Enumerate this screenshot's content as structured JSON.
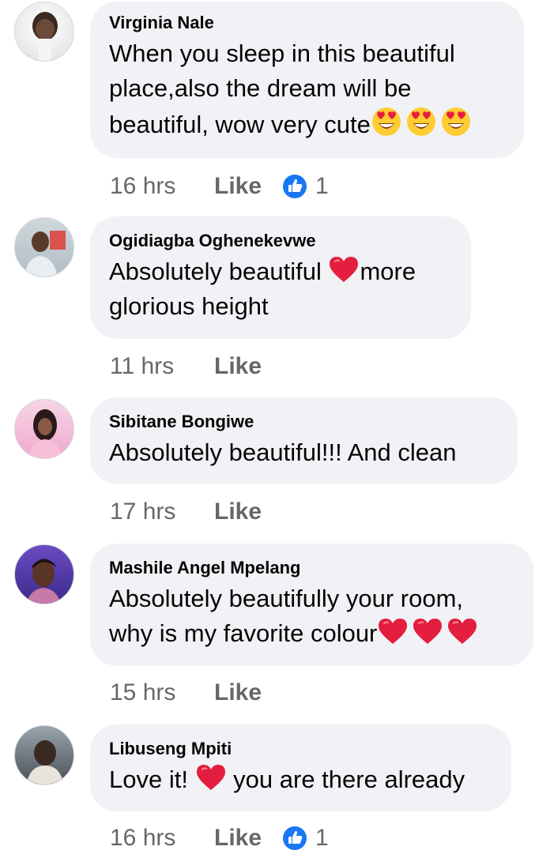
{
  "comments": [
    {
      "author": "Virginia Nale",
      "text_parts": [
        "When you sleep in this beautiful place,also the dream will be beautiful, wow very cute"
      ],
      "emojis": [
        "heart-eyes-emoji",
        "heart-eyes-emoji",
        "heart-eyes-emoji"
      ],
      "time": "16 hrs",
      "like_label": "Like",
      "reaction_count": "1"
    },
    {
      "author": "Ogidiagba Oghenekevwe",
      "text_parts": [
        "Absolutely beautiful ",
        "more glorious height"
      ],
      "emojis": [
        "red-heart-emoji"
      ],
      "time": "11 hrs",
      "like_label": "Like"
    },
    {
      "author": "Sibitane Bongiwe",
      "text_parts": [
        "Absolutely beautiful!!! And clean"
      ],
      "time": "17 hrs",
      "like_label": "Like"
    },
    {
      "author": "Mashile Angel Mpelang",
      "text_parts": [
        "Absolutely beautifully your room, why is my favorite colour"
      ],
      "emojis": [
        "red-heart-emoji",
        "red-heart-emoji",
        "red-heart-emoji"
      ],
      "time": "15 hrs",
      "like_label": "Like"
    },
    {
      "author": "Libuseng Mpiti",
      "text_parts": [
        "Love it! ",
        " you are there already"
      ],
      "emojis": [
        "red-heart-emoji"
      ],
      "time": "16 hrs",
      "like_label": "Like",
      "reaction_count": "1"
    }
  ],
  "colors": {
    "bubble": "#f0f2f5",
    "meta_text": "#65676b",
    "like_reaction": "#1877f2",
    "heart": "#e41e3f",
    "emoji_face": "#ffcc33"
  }
}
